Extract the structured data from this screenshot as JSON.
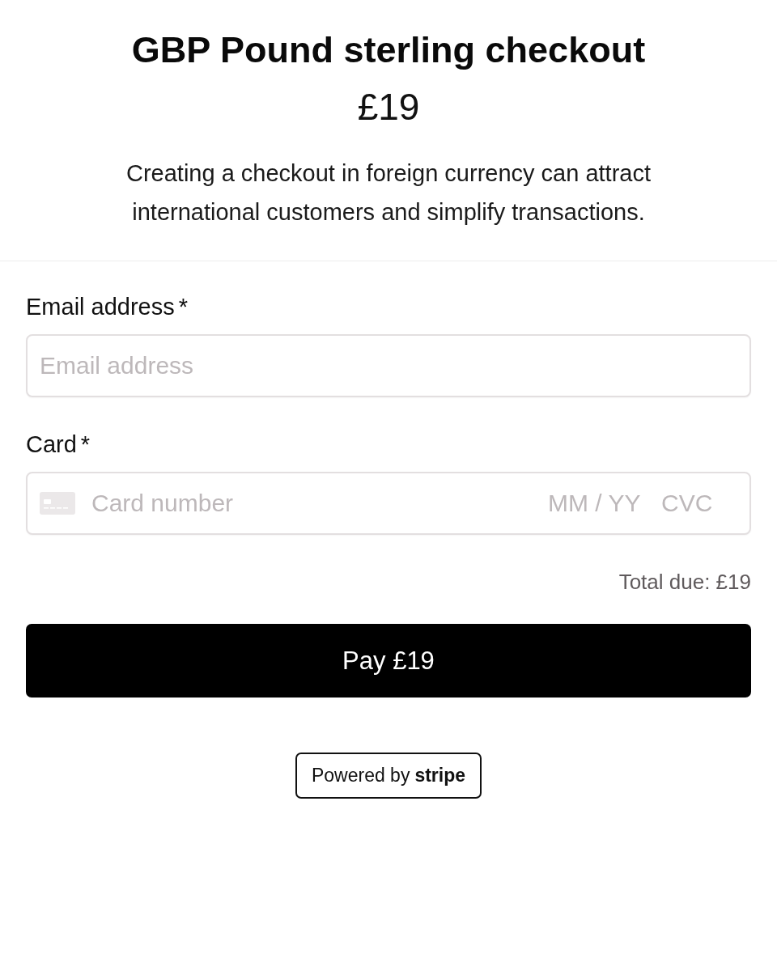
{
  "header": {
    "title": "GBP Pound sterling checkout",
    "price": "£19",
    "description": "Creating a checkout in foreign currency can attract international customers and simplify transactions."
  },
  "fields": [
    {
      "kind": "email",
      "label": "Email address",
      "required_mark": "*",
      "placeholder": "Email address"
    },
    {
      "kind": "card",
      "label": "Card",
      "required_mark": "*",
      "placeholder": "Card number",
      "expiry_placeholder": "MM / YY",
      "cvc_placeholder": "CVC"
    }
  ],
  "total": "Total due: £19",
  "pay_button": "Pay £19",
  "badge": "Powered by **stripe**"
}
